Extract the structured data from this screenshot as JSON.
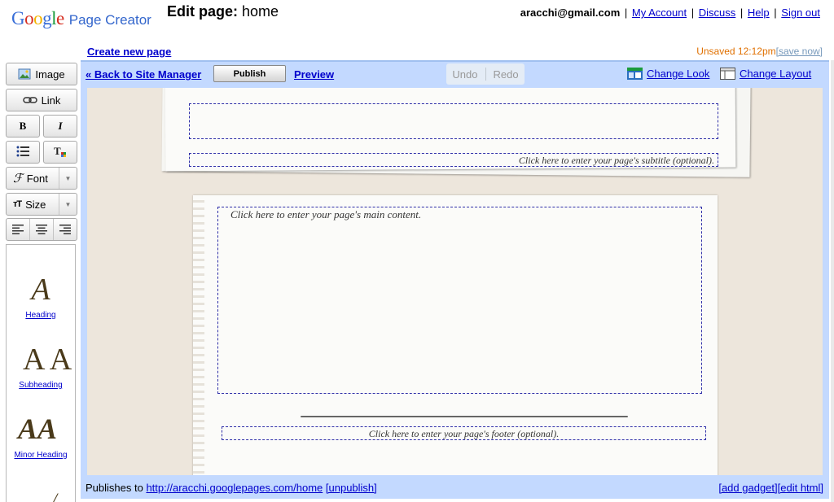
{
  "header": {
    "logo_text": "Google",
    "product_name": "Page Creator",
    "edit_label": "Edit page:",
    "page_name": "home"
  },
  "user": {
    "email": "aracchi@gmail.com",
    "links": [
      "My Account",
      "Discuss",
      "Help",
      "Sign out"
    ]
  },
  "create_new_page": "Create new page",
  "save_status": {
    "unsaved_label": "Unsaved 12:12pm",
    "save_now": "[save now]"
  },
  "toolbar": {
    "image_label": "Image",
    "link_label": "Link",
    "bold_label": "B",
    "italic_label": "I",
    "font_label": "Font",
    "size_label": "Size"
  },
  "styles": [
    {
      "sample": "A",
      "name": "Heading"
    },
    {
      "sample": "A A",
      "name": "Subheading"
    },
    {
      "sample": "AA",
      "name": "Minor Heading"
    }
  ],
  "editor_bar": {
    "back": "« Back to Site Manager",
    "publish": "Publish",
    "preview": "Preview",
    "undo": "Undo",
    "redo": "Redo",
    "change_look": "Change Look",
    "change_layout": "Change Layout"
  },
  "canvas": {
    "subtitle_hint": "Click here to enter your page's subtitle (optional).",
    "main_hint": "Click here to enter your page's main content.",
    "footer_hint": "Click here to enter your page's footer (optional)."
  },
  "footer": {
    "publishes_to": "Publishes to",
    "url": "http://aracchi.googlepages.com/home",
    "unpublish": "[unpublish]",
    "add_gadget": "[add gadget]",
    "edit_html": "[edit html]"
  },
  "colors": {
    "link": "#0000cc",
    "frame": "#c3d9ff",
    "unsaved": "#e07000"
  }
}
